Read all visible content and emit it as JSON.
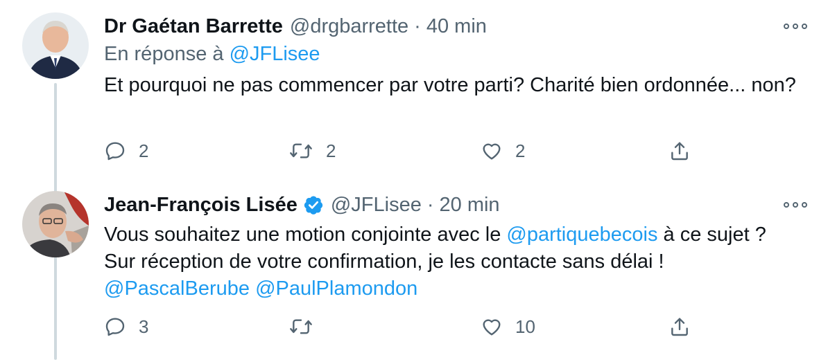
{
  "tweets": [
    {
      "author_name": "Dr Gaétan Barrette",
      "author_handle": "@drgbarrette",
      "separator": "·",
      "time": "40 min",
      "reply_prefix": "En réponse à",
      "reply_target": "@JFLisee",
      "text": "Et pourquoi ne pas commencer par votre parti? Charité bien ordonnée... non?",
      "replies": "2",
      "retweets": "2",
      "likes": "2"
    },
    {
      "author_name": "Jean-François Lisée",
      "author_handle": "@JFLisee",
      "verified": true,
      "separator": "·",
      "time": "20 min",
      "text_part1": "Vous souhaitez une motion conjointe avec le ",
      "mention1": "@partiquebecois",
      "text_part2": " à ce sujet ?",
      "text_line2": "Sur réception de votre confirmation, je les contacte sans délai !",
      "mention2": "@PascalBerube",
      "text_space": " ",
      "mention3": "@PaulPlamondon",
      "replies": "3",
      "retweets": "",
      "likes": "10"
    }
  ],
  "colors": {
    "link": "#1d9bf0",
    "secondary_text": "#536471",
    "thread_line": "#cfd9de",
    "verified_badge": "#1d9bf0"
  },
  "icons": [
    "more-icon",
    "reply-icon",
    "retweet-icon",
    "like-icon",
    "share-icon",
    "verified-icon"
  ]
}
